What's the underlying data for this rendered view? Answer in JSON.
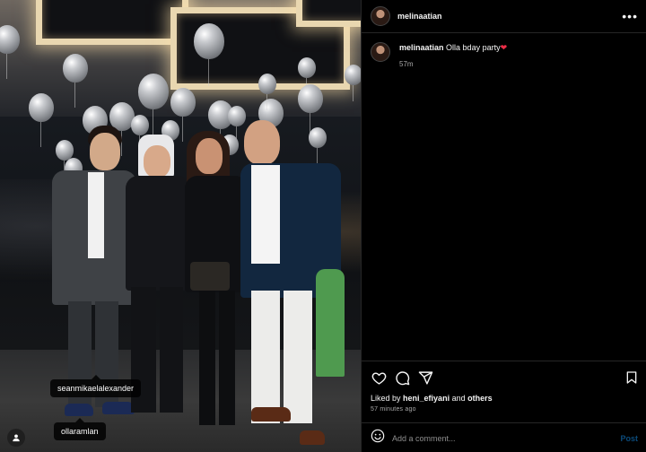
{
  "post": {
    "username": "melinaatian",
    "more_label": "•••"
  },
  "caption": {
    "username": "melinaatian",
    "text": "Olla bday party",
    "emoji": "❤",
    "time": "57m"
  },
  "photo_tags": [
    {
      "label": "seanmikaelalexander"
    },
    {
      "label": "ollaramlan"
    }
  ],
  "engagement": {
    "liked_by_prefix": "Liked by",
    "liked_by_user": "heni_efiyani",
    "liked_by_connector": "and",
    "liked_by_others": "others",
    "posted_ago": "57 minutes ago"
  },
  "comment": {
    "placeholder": "Add a comment...",
    "post_label": "Post"
  },
  "icons": {
    "like": "heart-icon",
    "comment": "comment-icon",
    "share": "send-icon",
    "save": "bookmark-icon",
    "emoji": "smiley-icon",
    "tags": "user-tag-icon",
    "more": "more-icon"
  },
  "colors": {
    "background": "#000000",
    "text": "#f5f5f5",
    "muted": "#a8a8a8",
    "divider": "#262626",
    "heart": "#ed2d47",
    "post_disabled": "#0b4a7a"
  }
}
